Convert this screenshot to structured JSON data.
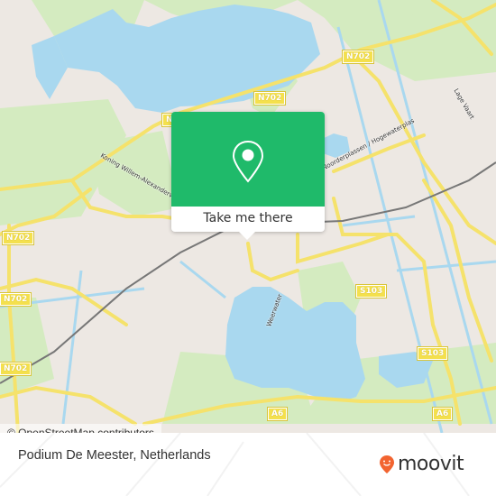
{
  "map": {
    "road_shields": [
      {
        "label": "N702",
        "pos": "top-right"
      },
      {
        "label": "N702",
        "pos": "top-center"
      },
      {
        "label": "N702",
        "pos": "left-upper"
      },
      {
        "label": "N702",
        "pos": "left-middle"
      },
      {
        "label": "N702",
        "pos": "left-lower"
      },
      {
        "label": "S103",
        "pos": "center-right"
      },
      {
        "label": "S103",
        "pos": "right"
      },
      {
        "label": "A6",
        "pos": "bottom-center"
      },
      {
        "label": "A6",
        "pos": "bottom-right"
      }
    ],
    "street_labels": [
      {
        "label": "Koning Willem-Alexanderwetering"
      },
      {
        "label": "Lage Vaart"
      },
      {
        "label": "Weerwater"
      },
      {
        "label": "Noorderplassen / Hogewaterplas"
      }
    ],
    "colors": {
      "water": "#a9d8ef",
      "land": "#ede8e3",
      "park": "#d4ebc0",
      "road": "#f5e26b",
      "rail": "#777777"
    }
  },
  "popup": {
    "icon": "map-pin-icon",
    "label": "Take me there",
    "color": "#1fba6a"
  },
  "attribution": "© OpenStreetMap contributors",
  "footer": {
    "place_name": "Podium De Meester, Netherlands",
    "brand": "moovit",
    "brand_color": "#f26430"
  }
}
